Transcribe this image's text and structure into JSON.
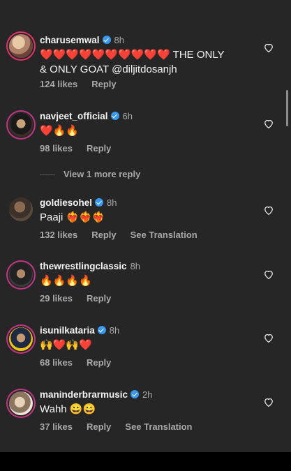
{
  "comments": [
    {
      "username": "charusemwal",
      "verified": true,
      "time": "8h",
      "text_line1": "❤️❤️❤️❤️❤️❤️❤️❤️❤️❤️ THE ONLY",
      "text_line2": "& ONLY GOAT @diljitdosanjh",
      "likes": "124 likes",
      "reply": "Reply",
      "translate": ""
    },
    {
      "username": "navjeet_official",
      "verified": true,
      "time": "6h",
      "text_line1": "❤️🔥🔥",
      "text_line2": "",
      "likes": "98 likes",
      "reply": "Reply",
      "translate": ""
    },
    {
      "username": "goldiesohel",
      "verified": true,
      "time": "8h",
      "text_line1": "Paaji ❤️‍🔥❤️‍🔥❤️‍🔥",
      "text_line2": "",
      "likes": "132 likes",
      "reply": "Reply",
      "translate": "See Translation"
    },
    {
      "username": "thewrestlingclassic",
      "verified": false,
      "time": "8h",
      "text_line1": "🔥🔥🔥🔥",
      "text_line2": "",
      "likes": "29 likes",
      "reply": "Reply",
      "translate": ""
    },
    {
      "username": "isunilkataria",
      "verified": true,
      "time": "8h",
      "text_line1": "🙌❤️🙌❤️",
      "text_line2": "",
      "likes": "68 likes",
      "reply": "Reply",
      "translate": ""
    },
    {
      "username": "maninderbrarmusic",
      "verified": true,
      "time": "2h",
      "text_line1": "Wahh 😀😀",
      "text_line2": "",
      "likes": "37 likes",
      "reply": "Reply",
      "translate": "See Translation"
    }
  ],
  "view_more_replies": "View 1 more reply",
  "icons": {
    "like": "heart-outline-icon",
    "verified": "verified-badge-icon"
  },
  "colors": {
    "background": "#262626",
    "verified": "#3897f0",
    "muted": "#a8a8a8"
  }
}
